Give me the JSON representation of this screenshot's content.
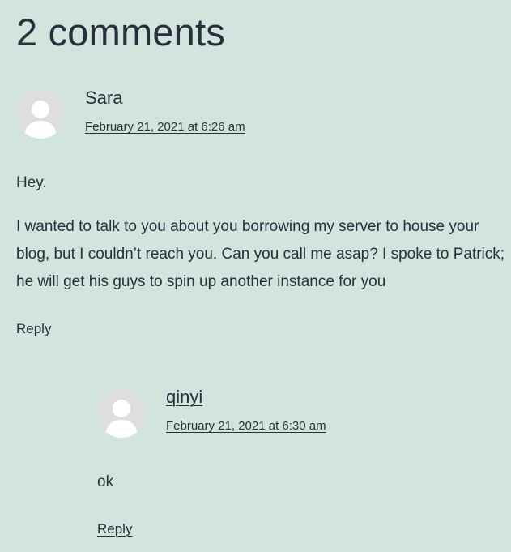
{
  "comments_title": "2 comments",
  "comments": [
    {
      "author": "Sara",
      "author_linked": false,
      "date": "February 21, 2021 at 6:26 am",
      "paragraphs": [
        "Hey.",
        "I wanted to talk to you about you borrowing my server to house your blog, but I couldn’t reach you. Can you call me asap? I spoke to Patrick; he will get his guys to spin up another instance for you"
      ],
      "reply_label": "Reply"
    },
    {
      "author": "qinyi",
      "author_linked": true,
      "date": "February 21, 2021 at 6:30 am",
      "paragraphs": [
        "ok"
      ],
      "reply_label": "Reply"
    }
  ],
  "colors": {
    "background": "#d1e4dd",
    "text": "#28303d",
    "avatar_bg": "#dedede",
    "avatar_figure": "#ffffff"
  },
  "icons": {
    "avatar": "default-user-avatar-icon"
  }
}
